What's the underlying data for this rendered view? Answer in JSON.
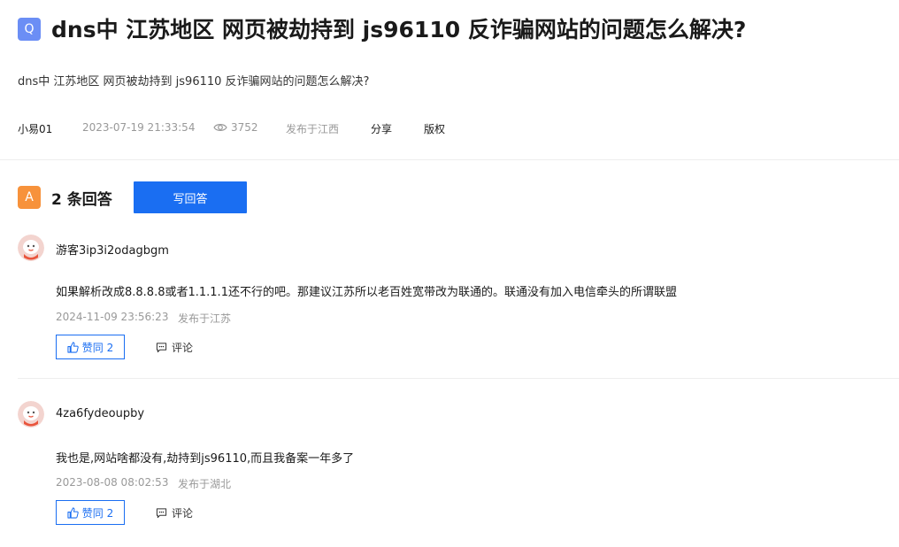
{
  "question": {
    "badge": "Q",
    "title": "dns中 江苏地区 网页被劫持到 js96110 反诈骗网站的问题怎么解决?",
    "description": "dns中 江苏地区 网页被劫持到 js96110 反诈骗网站的问题怎么解决?",
    "author": "小易01",
    "time": "2023-07-19 21:33:54",
    "views": "3752",
    "location": "发布于江西",
    "share_label": "分享",
    "copyright_label": "版权"
  },
  "answers_header": {
    "badge": "A",
    "count_label": "2 条回答",
    "write_button": "写回答"
  },
  "answers": [
    {
      "user": "游客3ip3i2odagbgm",
      "content": "如果解析改成8.8.8.8或者1.1.1.1还不行的吧。那建议江苏所以老百姓宽带改为联通的。联通没有加入电信牵头的所谓联盟",
      "time": "2024-11-09 23:56:23",
      "location": "发布于江苏",
      "like_label": "赞同 2",
      "comment_label": "评论"
    },
    {
      "user": "4za6fydeoupby",
      "content": "我也是,网站啥都没有,劫持到js96110,而且我备案一年多了",
      "time": "2023-08-08 08:02:53",
      "location": "发布于湖北",
      "like_label": "赞同 2",
      "comment_label": "评论"
    }
  ],
  "colors": {
    "accent_blue": "#1a6ef2",
    "q_badge": "#6b8ef5",
    "a_badge": "#f7923b",
    "muted_text": "#999999"
  }
}
